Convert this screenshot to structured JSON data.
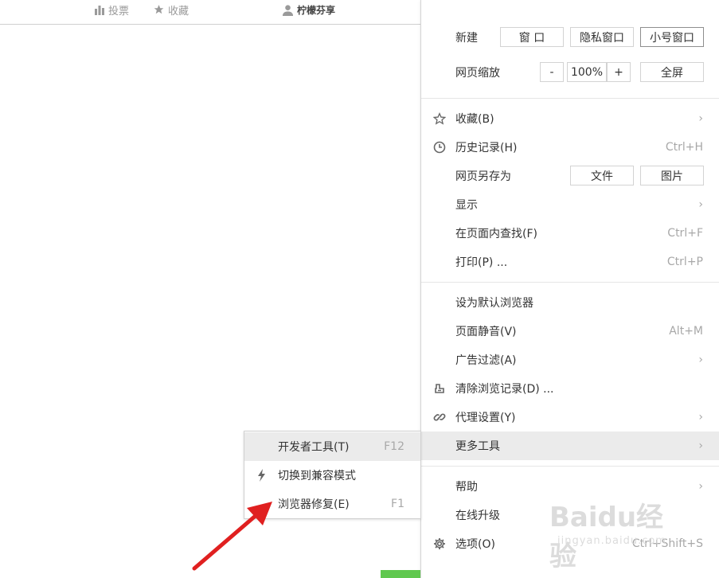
{
  "topbar": {
    "vote": "投票",
    "favorite": "收藏",
    "user": "柠檬芬享"
  },
  "menu": {
    "new_label": "新建",
    "new_window": "窗 口",
    "private_window": "隐私窗口",
    "small_window": "小号窗口",
    "zoom_label": "网页缩放",
    "zoom_minus": "-",
    "zoom_value": "100%",
    "zoom_plus": "+",
    "fullscreen": "全屏",
    "items": [
      {
        "label": "收藏(B)",
        "shortcut": "",
        "icon": "star-icon",
        "submenu": true
      },
      {
        "label": "历史记录(H)",
        "shortcut": "Ctrl+H",
        "icon": "clock-icon",
        "submenu": false
      },
      {
        "label": "网页另存为",
        "shortcut": "",
        "icon": "",
        "submenu": false
      },
      {
        "label": "显示",
        "shortcut": "",
        "icon": "",
        "submenu": true
      },
      {
        "label": "在页面内查找(F)",
        "shortcut": "Ctrl+F",
        "icon": "",
        "submenu": false
      },
      {
        "label": "打印(P) ...",
        "shortcut": "Ctrl+P",
        "icon": "",
        "submenu": false
      },
      {
        "label": "设为默认浏览器",
        "shortcut": "",
        "icon": "",
        "submenu": false
      },
      {
        "label": "页面静音(V)",
        "shortcut": "Alt+M",
        "icon": "",
        "submenu": false
      },
      {
        "label": "广告过滤(A)",
        "shortcut": "",
        "icon": "",
        "submenu": true
      },
      {
        "label": "清除浏览记录(D) ...",
        "shortcut": "",
        "icon": "eraser-icon",
        "submenu": false
      },
      {
        "label": "代理设置(Y)",
        "shortcut": "",
        "icon": "link-icon",
        "submenu": true
      },
      {
        "label": "更多工具",
        "shortcut": "",
        "icon": "",
        "submenu": true
      },
      {
        "label": "帮助",
        "shortcut": "",
        "icon": "",
        "submenu": true
      },
      {
        "label": "在线升级",
        "shortcut": "",
        "icon": "",
        "submenu": false
      },
      {
        "label": "选项(O)",
        "shortcut": "Ctrl+Shift+S",
        "icon": "gear-icon",
        "submenu": false
      }
    ],
    "save_file": "文件",
    "save_image": "图片",
    "chevron": "›"
  },
  "submenu": {
    "items": [
      {
        "label": "开发者工具(T)",
        "shortcut": "F12",
        "icon": ""
      },
      {
        "label": "切换到兼容模式",
        "shortcut": "",
        "icon": "lightning-icon"
      },
      {
        "label": "浏览器修复(E)",
        "shortcut": "F1",
        "icon": ""
      }
    ]
  },
  "watermark": {
    "text": "Baidu经验",
    "sub": "jingyan.baidu.com"
  },
  "colors": {
    "highlight": "#ebebeb",
    "arrow": "#e02020",
    "green": "#60c84f"
  }
}
